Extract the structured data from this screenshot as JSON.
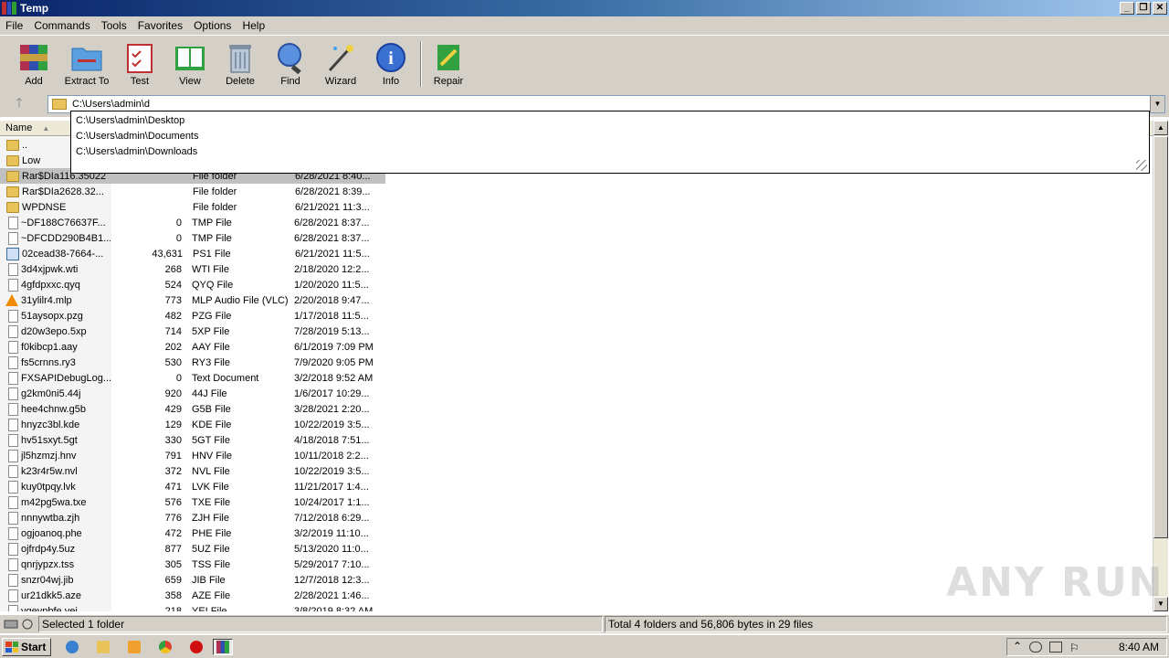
{
  "window": {
    "title": "Temp"
  },
  "menu": [
    "File",
    "Commands",
    "Tools",
    "Favorites",
    "Options",
    "Help"
  ],
  "toolbar": [
    {
      "label": "Add",
      "icon": "add-archive-icon"
    },
    {
      "label": "Extract To",
      "icon": "extract-to-icon"
    },
    {
      "label": "Test",
      "icon": "test-icon"
    },
    {
      "label": "View",
      "icon": "view-icon"
    },
    {
      "label": "Delete",
      "icon": "delete-icon"
    },
    {
      "label": "Find",
      "icon": "find-icon"
    },
    {
      "label": "Wizard",
      "icon": "wizard-icon"
    },
    {
      "label": "Info",
      "icon": "info-icon"
    },
    {
      "label": "Repair",
      "icon": "repair-icon"
    }
  ],
  "address": {
    "value": "C:\\Users\\admin\\d"
  },
  "autocomplete": [
    "C:\\Users\\admin\\Desktop",
    "C:\\Users\\admin\\Documents",
    "C:\\Users\\admin\\Downloads"
  ],
  "columns": {
    "name": "Name"
  },
  "files": [
    {
      "name": "..",
      "size": "",
      "type": "",
      "date": "",
      "icon": "up"
    },
    {
      "name": "Low",
      "size": "",
      "type": "",
      "date": "",
      "icon": "folder"
    },
    {
      "name": "Rar$DIa116.35022",
      "size": "",
      "type": "File folder",
      "date": "6/28/2021 8:40...",
      "icon": "folder",
      "selected": true
    },
    {
      "name": "Rar$DIa2628.32...",
      "size": "",
      "type": "File folder",
      "date": "6/28/2021 8:39...",
      "icon": "folder"
    },
    {
      "name": "WPDNSE",
      "size": "",
      "type": "File folder",
      "date": "6/21/2021 11:3...",
      "icon": "folder"
    },
    {
      "name": "~DF188C76637F...",
      "size": "0",
      "type": "TMP File",
      "date": "6/28/2021 8:37...",
      "icon": "file"
    },
    {
      "name": "~DFCDD290B4B1...",
      "size": "0",
      "type": "TMP File",
      "date": "6/28/2021 8:37...",
      "icon": "file"
    },
    {
      "name": "02cead38-7664-...",
      "size": "43,631",
      "type": "PS1 File",
      "date": "6/21/2021 11:5...",
      "icon": "ps1"
    },
    {
      "name": "3d4xjpwk.wti",
      "size": "268",
      "type": "WTI File",
      "date": "2/18/2020 12:2...",
      "icon": "file"
    },
    {
      "name": "4gfdpxxc.qyq",
      "size": "524",
      "type": "QYQ File",
      "date": "1/20/2020 11:5...",
      "icon": "file"
    },
    {
      "name": "31ylilr4.mlp",
      "size": "773",
      "type": "MLP Audio File (VLC)",
      "date": "2/20/2018 9:47...",
      "icon": "vlc"
    },
    {
      "name": "51aysopx.pzg",
      "size": "482",
      "type": "PZG File",
      "date": "1/17/2018 11:5...",
      "icon": "file"
    },
    {
      "name": "d20w3epo.5xp",
      "size": "714",
      "type": "5XP File",
      "date": "7/28/2019 5:13...",
      "icon": "file"
    },
    {
      "name": "f0kibcp1.aay",
      "size": "202",
      "type": "AAY File",
      "date": "6/1/2019 7:09 PM",
      "icon": "file"
    },
    {
      "name": "fs5crnns.ry3",
      "size": "530",
      "type": "RY3 File",
      "date": "7/9/2020 9:05 PM",
      "icon": "file"
    },
    {
      "name": "FXSAPIDebugLog...",
      "size": "0",
      "type": "Text Document",
      "date": "3/2/2018 9:52 AM",
      "icon": "file"
    },
    {
      "name": "g2km0ni5.44j",
      "size": "920",
      "type": "44J File",
      "date": "1/6/2017 10:29...",
      "icon": "file"
    },
    {
      "name": "hee4chnw.g5b",
      "size": "429",
      "type": "G5B File",
      "date": "3/28/2021 2:20...",
      "icon": "file"
    },
    {
      "name": "hnyzc3bl.kde",
      "size": "129",
      "type": "KDE File",
      "date": "10/22/2019 3:5...",
      "icon": "file"
    },
    {
      "name": "hv51sxyt.5gt",
      "size": "330",
      "type": "5GT File",
      "date": "4/18/2018 7:51...",
      "icon": "file"
    },
    {
      "name": "jl5hzmzj.hnv",
      "size": "791",
      "type": "HNV File",
      "date": "10/11/2018 2:2...",
      "icon": "file"
    },
    {
      "name": "k23r4r5w.nvl",
      "size": "372",
      "type": "NVL File",
      "date": "10/22/2019 3:5...",
      "icon": "file"
    },
    {
      "name": "kuy0tpqy.lvk",
      "size": "471",
      "type": "LVK File",
      "date": "11/21/2017 1:4...",
      "icon": "file"
    },
    {
      "name": "m42pg5wa.txe",
      "size": "576",
      "type": "TXE File",
      "date": "10/24/2017 1:1...",
      "icon": "file"
    },
    {
      "name": "nnnywtba.zjh",
      "size": "776",
      "type": "ZJH File",
      "date": "7/12/2018 6:29...",
      "icon": "file"
    },
    {
      "name": "ogjoanoq.phe",
      "size": "472",
      "type": "PHE File",
      "date": "3/2/2019 11:10...",
      "icon": "file"
    },
    {
      "name": "ojfrdp4y.5uz",
      "size": "877",
      "type": "5UZ File",
      "date": "5/13/2020 11:0...",
      "icon": "file"
    },
    {
      "name": "qnrjypzx.tss",
      "size": "305",
      "type": "TSS File",
      "date": "5/29/2017 7:10...",
      "icon": "file"
    },
    {
      "name": "snzr04wj.jib",
      "size": "659",
      "type": "JIB File",
      "date": "12/7/2018 12:3...",
      "icon": "file"
    },
    {
      "name": "ur21dkk5.aze",
      "size": "358",
      "type": "AZE File",
      "date": "2/28/2021 1:46...",
      "icon": "file"
    },
    {
      "name": "vgeypbfe.yei",
      "size": "218",
      "type": "YEI File",
      "date": "3/8/2019 8:32 AM",
      "icon": "file"
    }
  ],
  "status": {
    "left": "Selected 1 folder",
    "right": "Total 4 folders and 56,806 bytes in 29 files"
  },
  "taskbar": {
    "start": "Start",
    "clock": "8:40 AM"
  },
  "watermark": "ANY RUN"
}
